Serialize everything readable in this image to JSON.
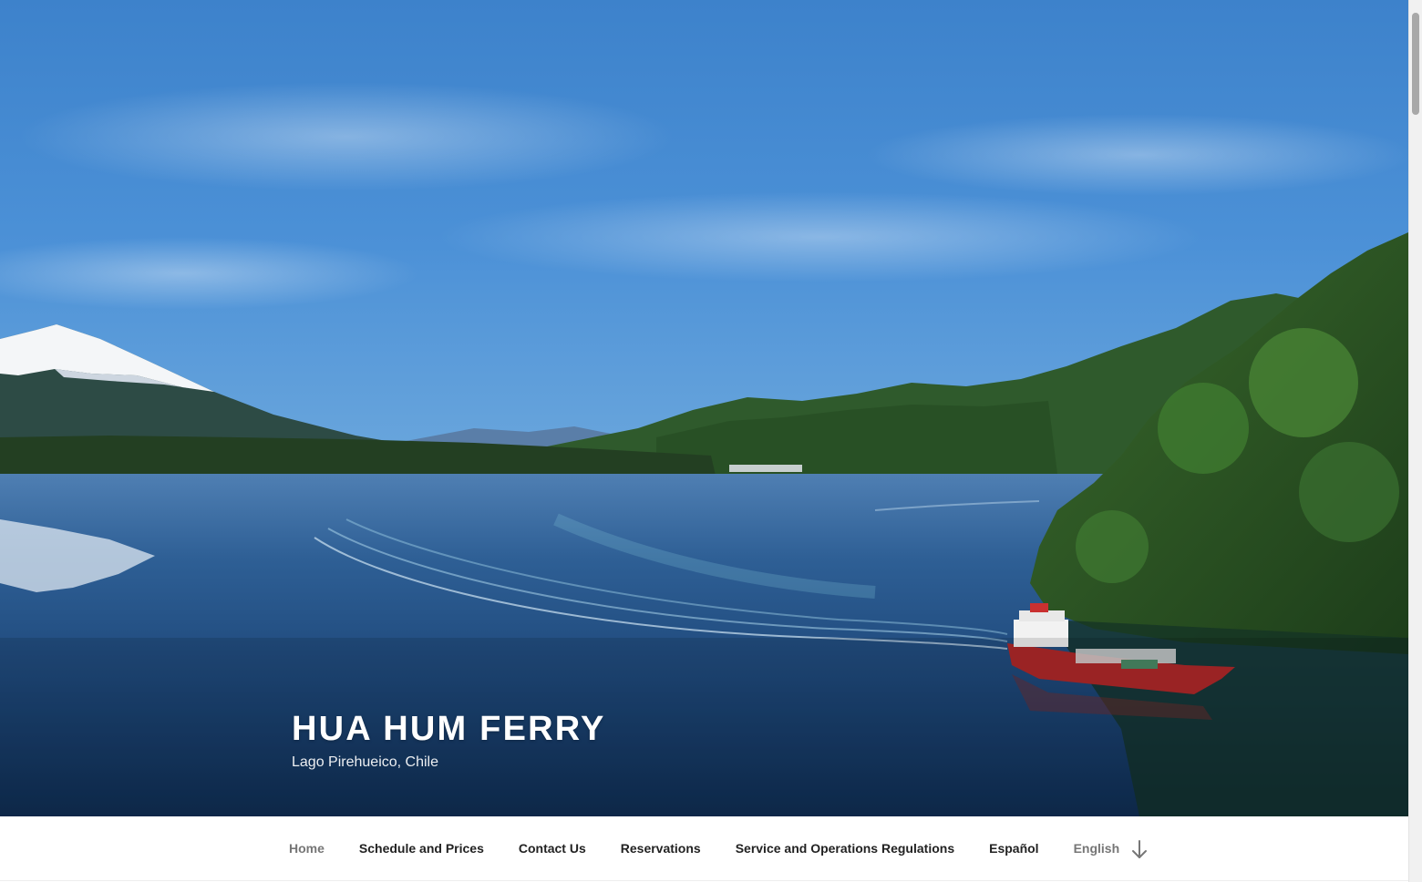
{
  "site": {
    "title": "HUA HUM FERRY",
    "description": "Lago Pirehueico, Chile"
  },
  "hero": {
    "image_subject": "ferry crossing lake with snow-capped volcano and forested hills",
    "sky_color": "#4a90d6",
    "water_color": "#1f4a7a",
    "forest_color": "#2f5a2a",
    "ferry_hull_color": "#b0282a"
  },
  "navigation": {
    "items": [
      {
        "label": "Home",
        "current": true
      },
      {
        "label": "Schedule and Prices",
        "current": false
      },
      {
        "label": "Contact Us",
        "current": false
      },
      {
        "label": "Reservations",
        "current": false
      },
      {
        "label": "Service and Operations Regulations",
        "current": false
      },
      {
        "label": "Español",
        "current": false
      },
      {
        "label": "English",
        "current": false
      }
    ],
    "scroll_icon": "arrow-down-icon"
  },
  "colors": {
    "nav_text": "#222222",
    "nav_muted": "#767676",
    "title_text": "#ffffff"
  }
}
